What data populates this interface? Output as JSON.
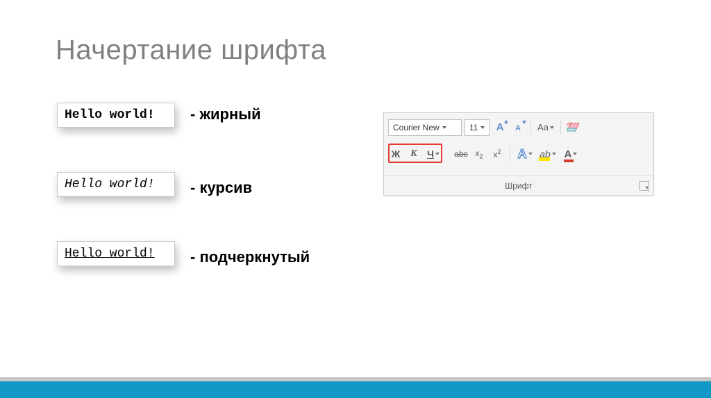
{
  "title": "Начертание шрифта",
  "examples": {
    "bold": {
      "text": "Hello world!",
      "label": "- жирный"
    },
    "italic": {
      "text": "Hello world!",
      "label": "- курсив"
    },
    "underline": {
      "text": "Hello world!",
      "label": "- подчеркнутый"
    }
  },
  "ribbon": {
    "group_label": "Шрифт",
    "font_name": "Courier New",
    "font_size": "11",
    "grow_font": "A",
    "shrink_font": "A",
    "change_case": "Aa",
    "bold": "Ж",
    "italic": "К",
    "underline": "Ч",
    "strike": "abc",
    "subscript_base": "x",
    "subscript_sub": "2",
    "superscript_base": "x",
    "superscript_sup": "2",
    "text_effects": "A",
    "highlight": "ab",
    "font_color": "A"
  },
  "colors": {
    "accent_bar": "#1198c6",
    "highlight_box": "#e63b2e"
  }
}
